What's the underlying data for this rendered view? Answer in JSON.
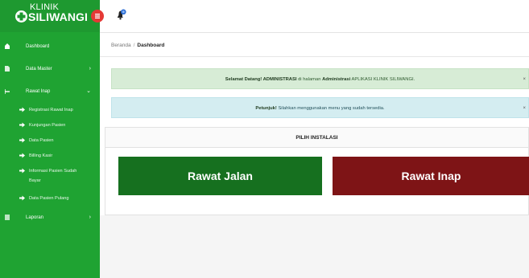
{
  "brand": {
    "line1": "KLINIK",
    "line2": "SILIWANGI"
  },
  "notifications": {
    "icon": "bell-icon",
    "badge_color": "#2d6fd6"
  },
  "sidebar": {
    "items": [
      {
        "label": "Dashboard",
        "icon": "home-icon",
        "arrow": ""
      },
      {
        "label": "Data Master",
        "icon": "file-icon",
        "arrow": "›"
      },
      {
        "label": "Rawat Inap",
        "icon": "bed-icon",
        "arrow": "⌄"
      }
    ],
    "subitems": [
      {
        "label": "Registrasi Rawat Inap"
      },
      {
        "label": "Kunjungan Pasien"
      },
      {
        "label": "Data Pasien"
      },
      {
        "label": "Billing Kasir"
      },
      {
        "label": "Informasi Pasien Sudah Bayar"
      },
      {
        "label": "Data Pasien Pulang"
      }
    ],
    "footer_item": {
      "label": "Laporan",
      "icon": "report-icon",
      "arrow": "›"
    }
  },
  "breadcrumb": {
    "home": "Beranda",
    "separator": "/",
    "current": "Dashboard"
  },
  "alerts": {
    "welcome": {
      "prefix": "Selamat Datang! ADMINISTRASI",
      "middle": " di halaman ",
      "strong": "Administrasi",
      "suffix": " APLIKASI KLINIK SILIWANGI."
    },
    "hint": {
      "strong": "Petunjuk!",
      "text": " Silahkan menggunakan menu yang sudah tersedia."
    }
  },
  "panel": {
    "title": "PILIH INSTALASI",
    "buttons": {
      "rawat_jalan": "Rawat Jalan",
      "rawat_inap": "Rawat Inap"
    }
  },
  "colors": {
    "sidebar": "#1fa332",
    "rawat_jalan": "#16701f",
    "rawat_inap": "#7e1416",
    "toggle": "#e53935"
  }
}
